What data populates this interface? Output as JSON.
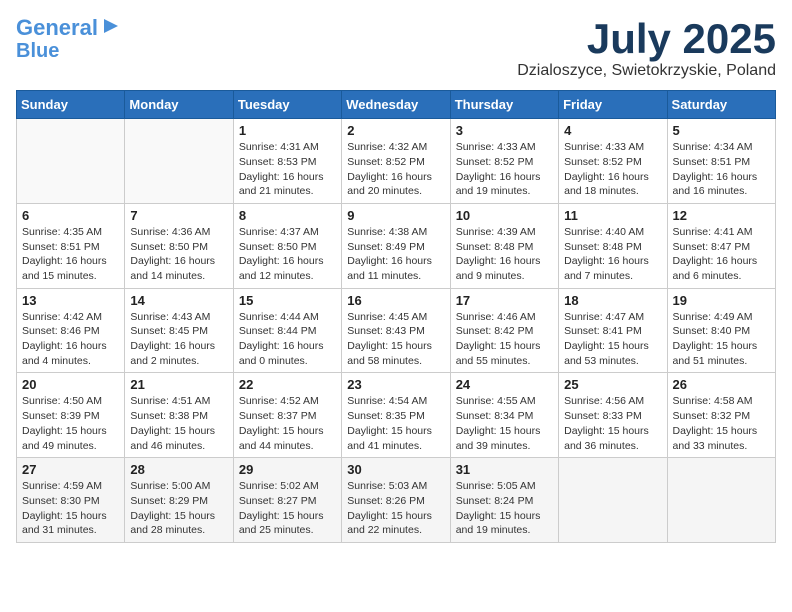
{
  "header": {
    "logo_line1": "General",
    "logo_line2": "Blue",
    "month_title": "July 2025",
    "location": "Dzialoszyce, Swietokrzyskie, Poland"
  },
  "weekdays": [
    "Sunday",
    "Monday",
    "Tuesday",
    "Wednesday",
    "Thursday",
    "Friday",
    "Saturday"
  ],
  "weeks": [
    [
      {
        "day": "",
        "info": ""
      },
      {
        "day": "",
        "info": ""
      },
      {
        "day": "1",
        "info": "Sunrise: 4:31 AM\nSunset: 8:53 PM\nDaylight: 16 hours\nand 21 minutes."
      },
      {
        "day": "2",
        "info": "Sunrise: 4:32 AM\nSunset: 8:52 PM\nDaylight: 16 hours\nand 20 minutes."
      },
      {
        "day": "3",
        "info": "Sunrise: 4:33 AM\nSunset: 8:52 PM\nDaylight: 16 hours\nand 19 minutes."
      },
      {
        "day": "4",
        "info": "Sunrise: 4:33 AM\nSunset: 8:52 PM\nDaylight: 16 hours\nand 18 minutes."
      },
      {
        "day": "5",
        "info": "Sunrise: 4:34 AM\nSunset: 8:51 PM\nDaylight: 16 hours\nand 16 minutes."
      }
    ],
    [
      {
        "day": "6",
        "info": "Sunrise: 4:35 AM\nSunset: 8:51 PM\nDaylight: 16 hours\nand 15 minutes."
      },
      {
        "day": "7",
        "info": "Sunrise: 4:36 AM\nSunset: 8:50 PM\nDaylight: 16 hours\nand 14 minutes."
      },
      {
        "day": "8",
        "info": "Sunrise: 4:37 AM\nSunset: 8:50 PM\nDaylight: 16 hours\nand 12 minutes."
      },
      {
        "day": "9",
        "info": "Sunrise: 4:38 AM\nSunset: 8:49 PM\nDaylight: 16 hours\nand 11 minutes."
      },
      {
        "day": "10",
        "info": "Sunrise: 4:39 AM\nSunset: 8:48 PM\nDaylight: 16 hours\nand 9 minutes."
      },
      {
        "day": "11",
        "info": "Sunrise: 4:40 AM\nSunset: 8:48 PM\nDaylight: 16 hours\nand 7 minutes."
      },
      {
        "day": "12",
        "info": "Sunrise: 4:41 AM\nSunset: 8:47 PM\nDaylight: 16 hours\nand 6 minutes."
      }
    ],
    [
      {
        "day": "13",
        "info": "Sunrise: 4:42 AM\nSunset: 8:46 PM\nDaylight: 16 hours\nand 4 minutes."
      },
      {
        "day": "14",
        "info": "Sunrise: 4:43 AM\nSunset: 8:45 PM\nDaylight: 16 hours\nand 2 minutes."
      },
      {
        "day": "15",
        "info": "Sunrise: 4:44 AM\nSunset: 8:44 PM\nDaylight: 16 hours\nand 0 minutes."
      },
      {
        "day": "16",
        "info": "Sunrise: 4:45 AM\nSunset: 8:43 PM\nDaylight: 15 hours\nand 58 minutes."
      },
      {
        "day": "17",
        "info": "Sunrise: 4:46 AM\nSunset: 8:42 PM\nDaylight: 15 hours\nand 55 minutes."
      },
      {
        "day": "18",
        "info": "Sunrise: 4:47 AM\nSunset: 8:41 PM\nDaylight: 15 hours\nand 53 minutes."
      },
      {
        "day": "19",
        "info": "Sunrise: 4:49 AM\nSunset: 8:40 PM\nDaylight: 15 hours\nand 51 minutes."
      }
    ],
    [
      {
        "day": "20",
        "info": "Sunrise: 4:50 AM\nSunset: 8:39 PM\nDaylight: 15 hours\nand 49 minutes."
      },
      {
        "day": "21",
        "info": "Sunrise: 4:51 AM\nSunset: 8:38 PM\nDaylight: 15 hours\nand 46 minutes."
      },
      {
        "day": "22",
        "info": "Sunrise: 4:52 AM\nSunset: 8:37 PM\nDaylight: 15 hours\nand 44 minutes."
      },
      {
        "day": "23",
        "info": "Sunrise: 4:54 AM\nSunset: 8:35 PM\nDaylight: 15 hours\nand 41 minutes."
      },
      {
        "day": "24",
        "info": "Sunrise: 4:55 AM\nSunset: 8:34 PM\nDaylight: 15 hours\nand 39 minutes."
      },
      {
        "day": "25",
        "info": "Sunrise: 4:56 AM\nSunset: 8:33 PM\nDaylight: 15 hours\nand 36 minutes."
      },
      {
        "day": "26",
        "info": "Sunrise: 4:58 AM\nSunset: 8:32 PM\nDaylight: 15 hours\nand 33 minutes."
      }
    ],
    [
      {
        "day": "27",
        "info": "Sunrise: 4:59 AM\nSunset: 8:30 PM\nDaylight: 15 hours\nand 31 minutes."
      },
      {
        "day": "28",
        "info": "Sunrise: 5:00 AM\nSunset: 8:29 PM\nDaylight: 15 hours\nand 28 minutes."
      },
      {
        "day": "29",
        "info": "Sunrise: 5:02 AM\nSunset: 8:27 PM\nDaylight: 15 hours\nand 25 minutes."
      },
      {
        "day": "30",
        "info": "Sunrise: 5:03 AM\nSunset: 8:26 PM\nDaylight: 15 hours\nand 22 minutes."
      },
      {
        "day": "31",
        "info": "Sunrise: 5:05 AM\nSunset: 8:24 PM\nDaylight: 15 hours\nand 19 minutes."
      },
      {
        "day": "",
        "info": ""
      },
      {
        "day": "",
        "info": ""
      }
    ]
  ]
}
